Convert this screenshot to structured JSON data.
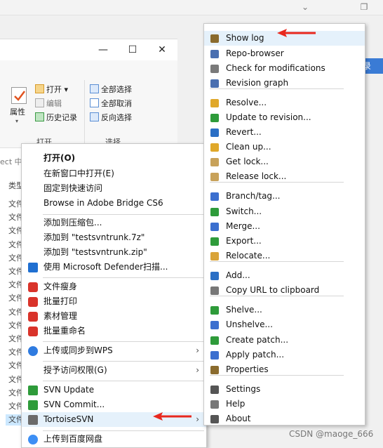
{
  "outer": {
    "chevron": "⌄",
    "restore": "❐"
  },
  "explorer": {
    "minimize": "—",
    "maximize": "☐",
    "close": "✕",
    "expand": "⌃",
    "help": "?",
    "ribbon": {
      "properties": "属性",
      "open": "打开 ▾",
      "edit": "编辑",
      "history": "历史记录",
      "open_group": "打开",
      "select_all": "全部选择",
      "select_none": "全部取消",
      "invert": "反向选择",
      "select_group": "选择"
    },
    "search_hint": "ect 中",
    "column_type": "类型",
    "file_label": "文件"
  },
  "blue_button_label": "录",
  "left_menu": {
    "items": [
      {
        "label": "打开(O)",
        "bold": true
      },
      {
        "label": "在新窗口中打开(E)"
      },
      {
        "label": "固定到快速访问"
      },
      {
        "label": "Browse in Adobe Bridge CS6"
      },
      {
        "label": "添加到压缩包..."
      },
      {
        "label": "添加到 \"testsvntrunk.7z\""
      },
      {
        "label": "添加到 \"testsvntrunk.zip\""
      },
      {
        "label": "使用 Microsoft Defender扫描..."
      },
      {
        "label": "文件瘦身"
      },
      {
        "label": "批量打印"
      },
      {
        "label": "素材管理"
      },
      {
        "label": "批量重命名"
      },
      {
        "label": "上传或同步到WPS"
      },
      {
        "label": "授予访问权限(G)"
      },
      {
        "label": "SVN Update"
      },
      {
        "label": "SVN Commit..."
      },
      {
        "label": "TortoiseSVN"
      },
      {
        "label": "上传到百度网盘"
      }
    ]
  },
  "right_menu": {
    "items": [
      {
        "label": "Show log",
        "icon": "log-icon"
      },
      {
        "label": "Repo-browser",
        "icon": "repo-browser-icon"
      },
      {
        "label": "Check for modifications",
        "icon": "check-modifications-icon"
      },
      {
        "label": "Revision graph",
        "icon": "revision-graph-icon"
      },
      {
        "label": "Resolve...",
        "icon": "resolve-icon"
      },
      {
        "label": "Update to revision...",
        "icon": "update-revision-icon"
      },
      {
        "label": "Revert...",
        "icon": "revert-icon"
      },
      {
        "label": "Clean up...",
        "icon": "cleanup-icon"
      },
      {
        "label": "Get lock...",
        "icon": "lock-icon"
      },
      {
        "label": "Release lock...",
        "icon": "unlock-icon"
      },
      {
        "label": "Branch/tag...",
        "icon": "branch-icon"
      },
      {
        "label": "Switch...",
        "icon": "switch-icon"
      },
      {
        "label": "Merge...",
        "icon": "merge-icon"
      },
      {
        "label": "Export...",
        "icon": "export-icon"
      },
      {
        "label": "Relocate...",
        "icon": "relocate-icon"
      },
      {
        "label": "Add...",
        "icon": "add-icon"
      },
      {
        "label": "Copy URL to clipboard",
        "icon": "copy-url-icon"
      },
      {
        "label": "Shelve...",
        "icon": "shelve-icon"
      },
      {
        "label": "Unshelve...",
        "icon": "unshelve-icon"
      },
      {
        "label": "Create patch...",
        "icon": "create-patch-icon"
      },
      {
        "label": "Apply patch...",
        "icon": "apply-patch-icon"
      },
      {
        "label": "Properties",
        "icon": "properties-icon"
      },
      {
        "label": "Settings",
        "icon": "settings-icon"
      },
      {
        "label": "Help",
        "icon": "help-icon"
      },
      {
        "label": "About",
        "icon": "about-icon"
      }
    ]
  },
  "watermark": "CSDN @maoge_666",
  "colors": {
    "accent": "#3a7bd5",
    "annotation_arrow": "#e8281e",
    "wps_red": "#d9332a",
    "svn_green": "#2e9b3a"
  }
}
